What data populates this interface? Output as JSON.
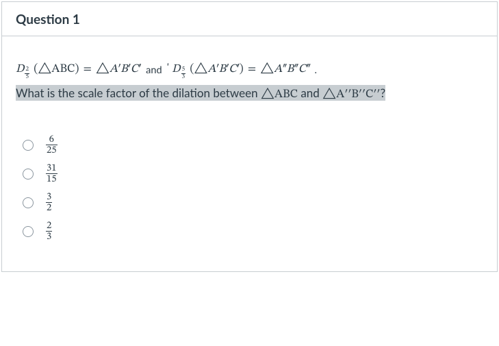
{
  "question": {
    "title": "Question 1",
    "d1_sub_num": "2",
    "d1_sub_den": "5",
    "d1_arg": "(△ABC)",
    "eq": "=",
    "d1_rhs_A": "A",
    "d1_rhs_B": "B",
    "d1_rhs_C": "C",
    "and": "and",
    "comma_sp": "' ",
    "d2_sub_num": "5",
    "d2_sub_den": "3",
    "d2_arg_open": "(△",
    "d2_arg_close": ")",
    "rhs2_A": "A",
    "rhs2_B": "B",
    "rhs2_C": "C",
    "period": ".",
    "prompt_pre": "What is the scale factor of the dilation between ",
    "tri": "△",
    "abc": "ABC",
    "prompt_mid": " and ",
    "a2b2c2_A": "A",
    "a2b2c2_B": "B",
    "a2b2c2_C": "C",
    "prompt_q": "?"
  },
  "options": [
    {
      "num": "6",
      "den": "25"
    },
    {
      "num": "31",
      "den": "15"
    },
    {
      "num": "3",
      "den": "2"
    },
    {
      "num": "2",
      "den": "3"
    }
  ]
}
